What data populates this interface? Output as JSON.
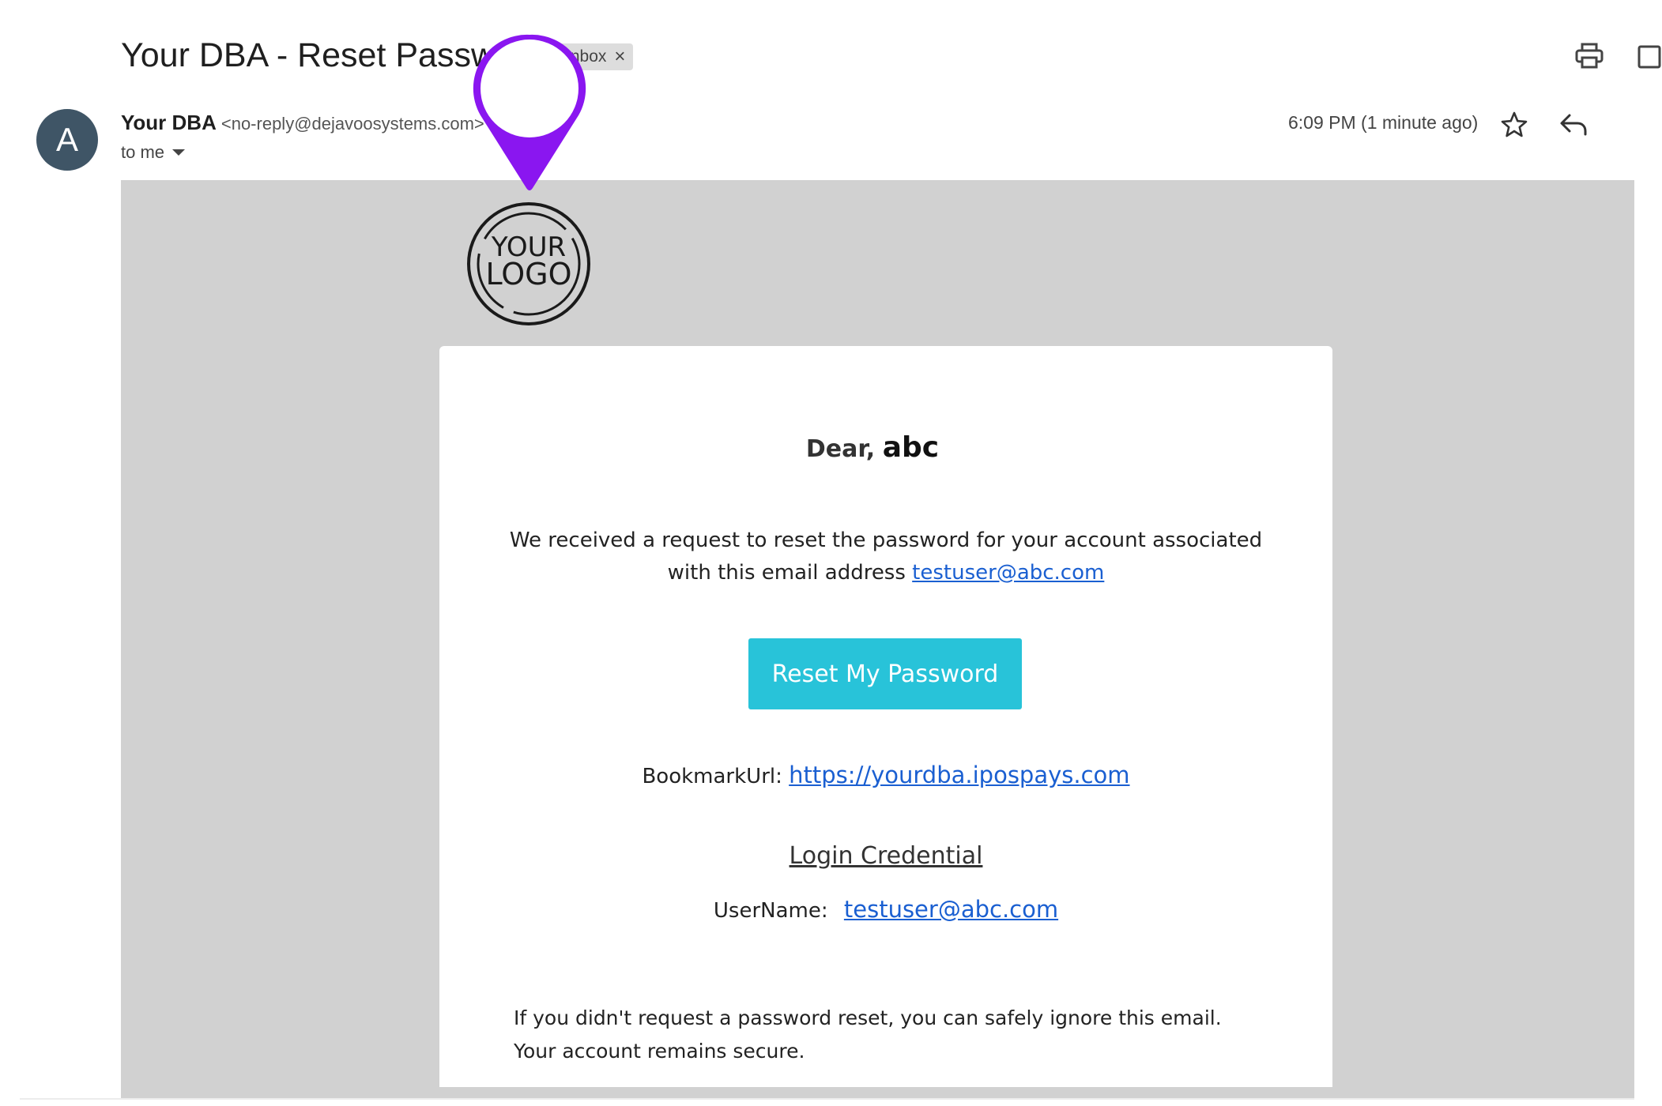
{
  "header": {
    "subject": "Your DBA - Reset Password",
    "label_chip": "Inbox",
    "print_icon": "print-icon",
    "open_in_new_window_icon": "open-in-new-window-icon"
  },
  "sender": {
    "avatar_initial": "A",
    "name": "Your DBA",
    "email": "<no-reply@dejavoosystems.com>",
    "to_label": "to me",
    "time": "6:09 PM (1 minute ago)"
  },
  "email": {
    "logo_text_1": "YOUR",
    "logo_text_2": "LOGO",
    "dear_prefix": "Dear,",
    "dear_name": "abc",
    "request_line_1": "We received a request to reset the password for your account associated",
    "request_line_2": "with this email address",
    "request_email": "testuser@abc.com",
    "reset_button": "Reset My Password",
    "bookmark_label": "BookmarkUrl:",
    "bookmark_url": "https://yourdba.ipospays.com",
    "credential_title": "Login Credential",
    "username_label": "UserName:",
    "username_value": "testuser@abc.com",
    "ignore_line_1": "If you didn't request a password reset, you can safely ignore this email.",
    "ignore_line_2": "Your account remains secure."
  },
  "colors": {
    "avatar_bg": "#3f5566",
    "email_background": "#d1d1d1",
    "button": "#28c3d9",
    "link": "#1a5fd1",
    "pin": "#8a16f0"
  }
}
